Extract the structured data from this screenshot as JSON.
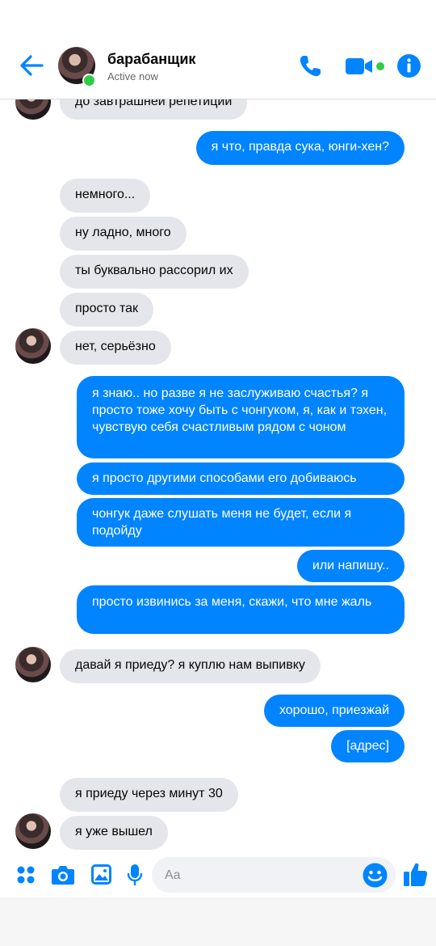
{
  "header": {
    "contact_name": "барабанщик",
    "status": "Active now",
    "icons": [
      "back-arrow-icon",
      "phone-icon",
      "video-camera-icon",
      "info-icon"
    ],
    "accent_color": "#0084ff",
    "online_color": "#31cc46"
  },
  "messages": [
    {
      "side": "in",
      "text": "до завтрашней репетиции"
    },
    {
      "side": "out",
      "text": "я что, правда сука, юнги-хен?"
    },
    {
      "side": "in",
      "text": "немного..."
    },
    {
      "side": "in",
      "text": "ну ладно, много"
    },
    {
      "side": "in",
      "text": "ты буквально рассорил их"
    },
    {
      "side": "in",
      "text": "просто так"
    },
    {
      "side": "in",
      "text": "нет, серьёзно"
    },
    {
      "side": "out",
      "text": "я знаю.. но разве я не заслуживаю счастья? я просто тоже хочу быть с чонгуком, я, как и тэхен, чувствую себя счастливым рядом с чоном"
    },
    {
      "side": "out",
      "text": "я просто другими способами его добиваюсь"
    },
    {
      "side": "out",
      "text": "чонгук даже слушать меня не будет, если я подойду"
    },
    {
      "side": "out",
      "text": "или напишу.."
    },
    {
      "side": "out",
      "text": "просто извинись за меня, скажи, что мне жаль"
    },
    {
      "side": "in",
      "text": "давай я приеду? я куплю нам выпивку"
    },
    {
      "side": "out",
      "text": "хорошо, приезжай"
    },
    {
      "side": "out",
      "text": "[адрес]"
    },
    {
      "side": "in",
      "text": "я приеду через минут 30"
    },
    {
      "side": "in",
      "text": "я уже вышел"
    }
  ],
  "composer": {
    "placeholder": "Aa",
    "icons": [
      "menu-dots-icon",
      "camera-icon",
      "gallery-icon",
      "microphone-icon",
      "emoji-icon",
      "like-icon"
    ]
  }
}
